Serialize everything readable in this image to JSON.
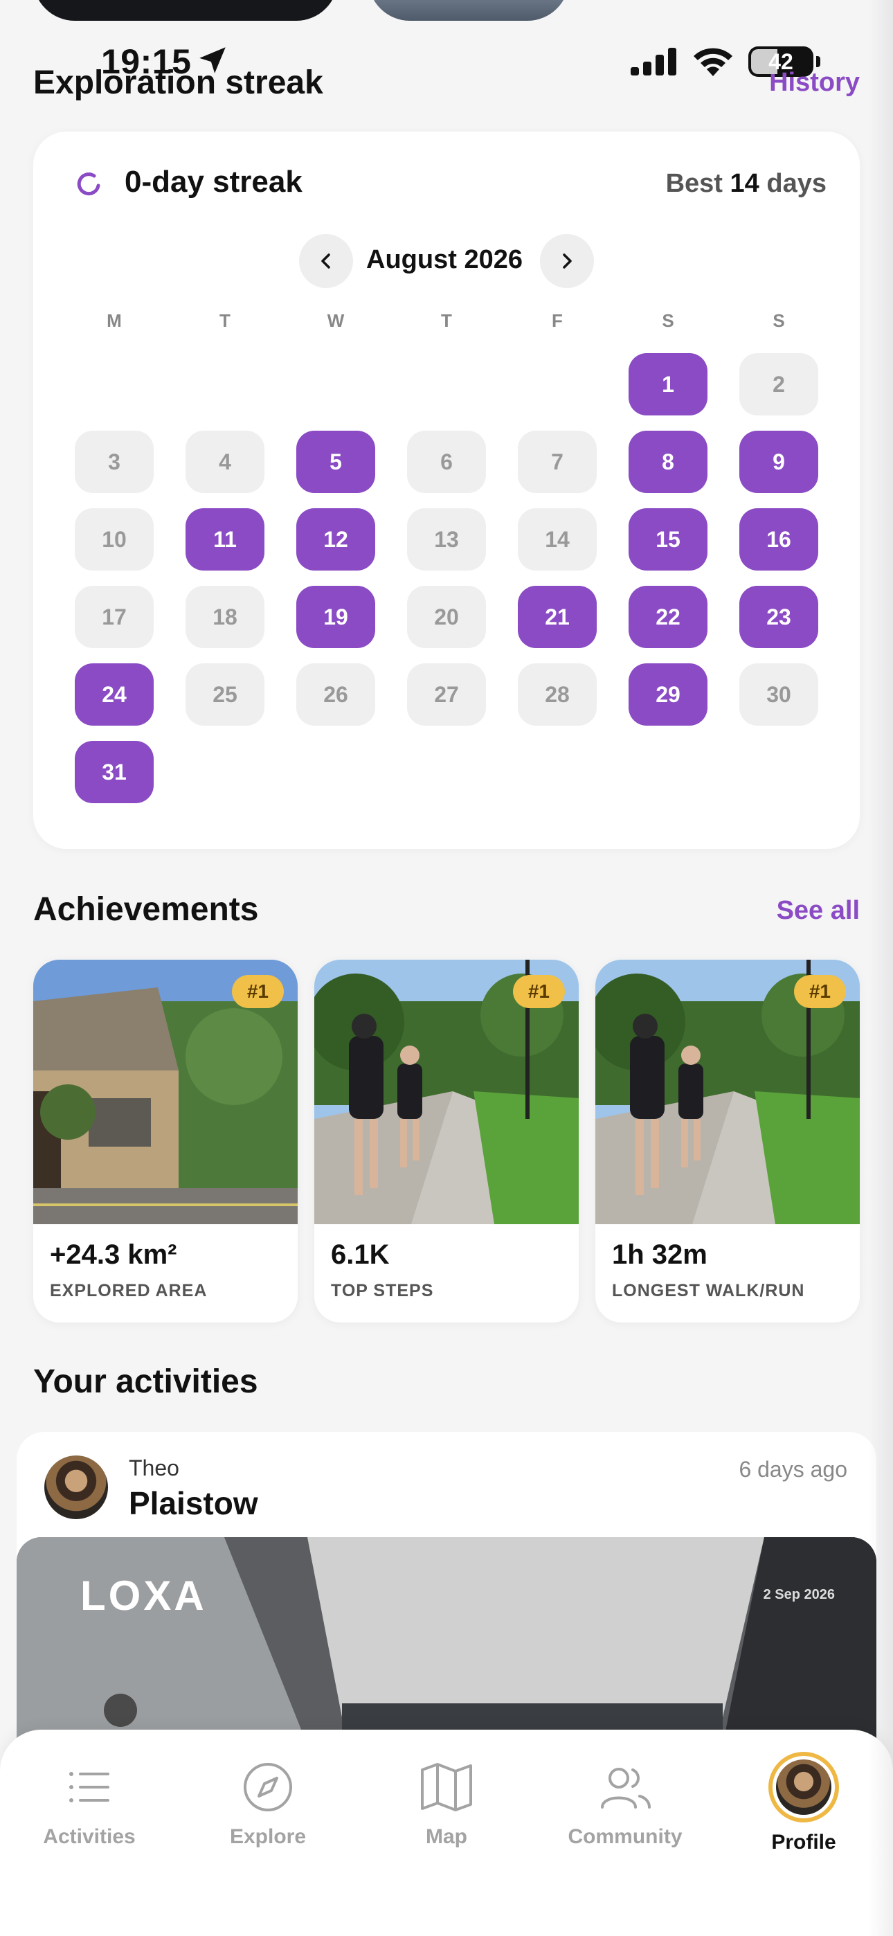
{
  "status_bar": {
    "time": "19:15",
    "battery": "42"
  },
  "streak_section": {
    "title": "Exploration streak",
    "history_link": "History",
    "streak_label": "0-day streak",
    "best_prefix": "Best",
    "best_value": "14",
    "best_suffix": "days",
    "month": "August 2026",
    "weekdays": [
      "M",
      "T",
      "W",
      "T",
      "F",
      "S",
      "S"
    ],
    "leading_blanks": 5,
    "days": [
      {
        "d": "1",
        "on": true
      },
      {
        "d": "2",
        "on": false
      },
      {
        "d": "3",
        "on": false
      },
      {
        "d": "4",
        "on": false
      },
      {
        "d": "5",
        "on": true
      },
      {
        "d": "6",
        "on": false
      },
      {
        "d": "7",
        "on": false
      },
      {
        "d": "8",
        "on": true
      },
      {
        "d": "9",
        "on": true
      },
      {
        "d": "10",
        "on": false
      },
      {
        "d": "11",
        "on": true
      },
      {
        "d": "12",
        "on": true
      },
      {
        "d": "13",
        "on": false
      },
      {
        "d": "14",
        "on": false
      },
      {
        "d": "15",
        "on": true
      },
      {
        "d": "16",
        "on": true
      },
      {
        "d": "17",
        "on": false
      },
      {
        "d": "18",
        "on": false
      },
      {
        "d": "19",
        "on": true
      },
      {
        "d": "20",
        "on": false
      },
      {
        "d": "21",
        "on": true
      },
      {
        "d": "22",
        "on": true
      },
      {
        "d": "23",
        "on": true
      },
      {
        "d": "24",
        "on": true
      },
      {
        "d": "25",
        "on": false
      },
      {
        "d": "26",
        "on": false
      },
      {
        "d": "27",
        "on": false
      },
      {
        "d": "28",
        "on": false
      },
      {
        "d": "29",
        "on": true
      },
      {
        "d": "30",
        "on": false
      },
      {
        "d": "31",
        "on": true
      }
    ],
    "colors": {
      "active": "#8a4bc4",
      "inactive": "#efefef"
    }
  },
  "achievements": {
    "title": "Achievements",
    "see_all": "See all",
    "items": [
      {
        "rank": "#1",
        "value": "+24.3 km²",
        "label": "EXPLORED AREA",
        "image": "stone-cottage"
      },
      {
        "rank": "#1",
        "value": "6.1K",
        "label": "TOP STEPS",
        "image": "runners-park"
      },
      {
        "rank": "#1",
        "value": "1h 32m",
        "label": "LONGEST WALK/RUN",
        "image": "runners-park"
      }
    ]
  },
  "activities": {
    "title": "Your activities",
    "items": [
      {
        "user": "Theo",
        "place": "Plaistow",
        "when": "6 days ago",
        "brand": "LOXA",
        "photo_date": "2 Sep 2026"
      }
    ]
  },
  "tab_bar": {
    "tabs": [
      {
        "label": "Activities",
        "icon": "list-icon"
      },
      {
        "label": "Explore",
        "icon": "compass-icon"
      },
      {
        "label": "Map",
        "icon": "map-icon"
      },
      {
        "label": "Community",
        "icon": "people-icon"
      },
      {
        "label": "Profile",
        "icon": "avatar",
        "active": true
      }
    ]
  }
}
